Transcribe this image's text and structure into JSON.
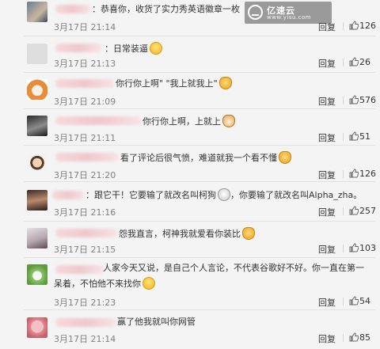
{
  "watermark": {
    "title": "亿速云",
    "subtitle": "www.yisu.com"
  },
  "comments": [
    {
      "text": "：恭喜你，收货了实力秀英语徽章一枚",
      "time": "3月17日 21:14",
      "reply": "回复",
      "likes": "126",
      "emoji": ""
    },
    {
      "text": "：日常装逼",
      "time": "3月17日 21:13",
      "reply": "回复",
      "likes": "26",
      "emoji": "smile-emoji"
    },
    {
      "text": "你行你上啊\" \"我上就我上\"",
      "time": "3月17日 21:09",
      "reply": "回复",
      "likes": "576",
      "emoji": "cat-emoji"
    },
    {
      "text": "你行你上啊，上就上",
      "time": "3月17日 21:11",
      "reply": "回复",
      "likes": "51",
      "emoji": "shiba-emoji"
    },
    {
      "text": "看了评论后很气愤，难道就我一个看不懂",
      "time": "3月17日 21:20",
      "reply": "回复",
      "likes": "126",
      "emoji": "cat-emoji"
    },
    {
      "text": "：跟它干！它要输了就改名叫柯狗",
      "text2": "，你要输了就改名叫Alpha_zha。",
      "time": "3月17日 21:16",
      "reply": "回复",
      "likes": "257",
      "emoji": "dog-emoji"
    },
    {
      "text": "怨我直言，柯神我就爱看你装比",
      "time": "3月17日 21:15",
      "reply": "回复",
      "likes": "103",
      "emoji": "cat-emoji"
    },
    {
      "text": "人家今天又说，是自己个人言论，不代表谷歌好不好。你一直在第一呆着，不怕他不来找你",
      "time": "3月17日 21:23",
      "reply": "回复",
      "likes": "54",
      "emoji": "laugh-emoji"
    },
    {
      "text": "赢了他我就叫你网管",
      "time": "3月17日 21:14",
      "reply": "回复",
      "likes": "85",
      "emoji": ""
    }
  ],
  "colors": {
    "background": "#f4f4f4",
    "time": "#808080",
    "text": "#333333"
  }
}
